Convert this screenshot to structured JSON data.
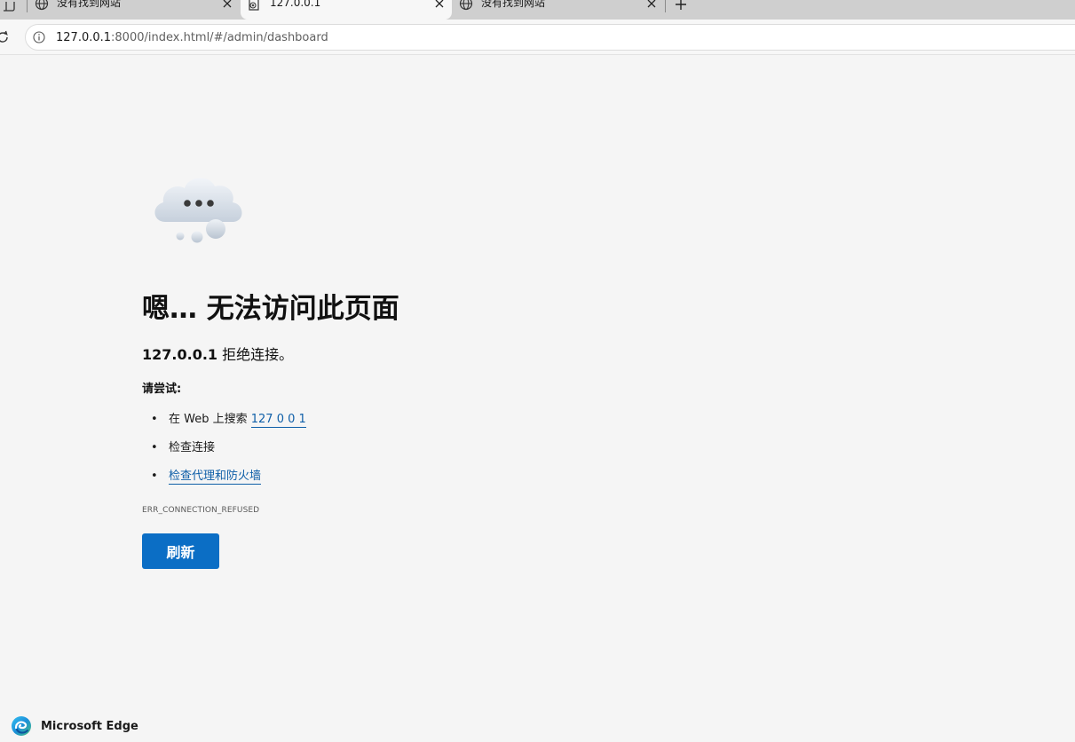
{
  "tabs": [
    {
      "title": "没有找到网站",
      "favicon": "globe-icon",
      "active": false
    },
    {
      "title": "127.0.0.1",
      "favicon": "broken-page-icon",
      "active": true
    },
    {
      "title": "没有找到网站",
      "favicon": "globe-icon",
      "active": false
    }
  ],
  "toolbar": {
    "url_host": "127.0.0.1",
    "url_rest": ":8000/index.html/#/admin/dashboard"
  },
  "error": {
    "headline": "嗯… 无法访问此页面",
    "host": "127.0.0.1",
    "message": " 拒绝连接。",
    "try_label": "请尝试:",
    "suggestions": {
      "search_prefix": "在 Web 上搜索 ",
      "search_link": "127 0 0 1",
      "check_connection": "检查连接",
      "check_proxy_link": "检查代理和防火墙"
    },
    "code": "ERR_CONNECTION_REFUSED",
    "refresh_label": "刷新"
  },
  "brand": {
    "name": "Microsoft Edge"
  },
  "colors": {
    "accent": "#0b6ec5",
    "link": "#0f5fa8",
    "page_bg": "#f5f5f5",
    "tabstrip_bg": "#cfcfcf"
  }
}
